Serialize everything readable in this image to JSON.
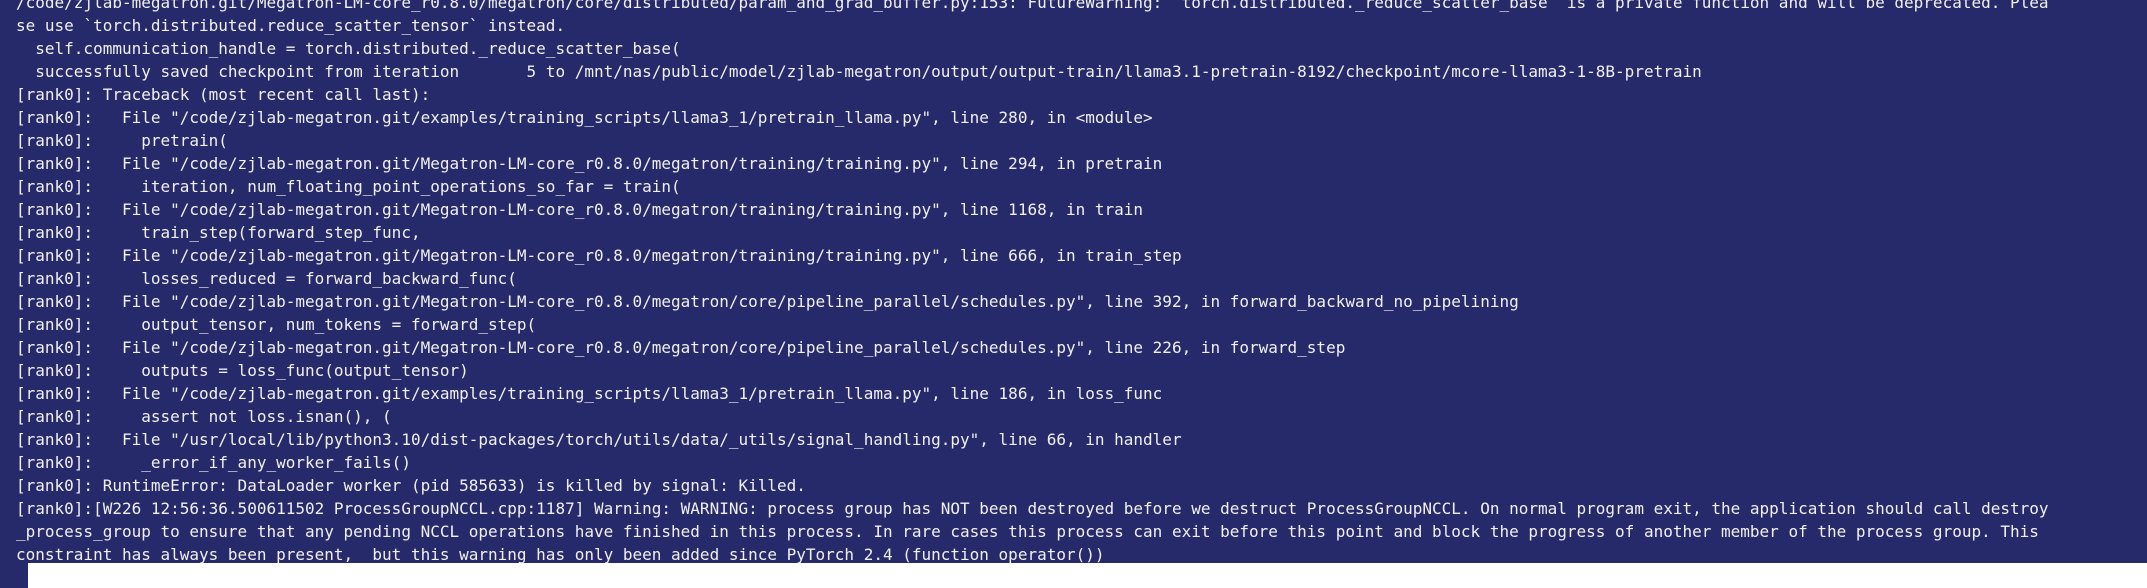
{
  "terminal": {
    "lines": [
      "/code/zjlab-megatron.git/Megatron-LM-core_r0.8.0/megatron/core/distributed/param_and_grad_buffer.py:153: FutureWarning: `torch.distributed._reduce_scatter_base` is a private function and will be deprecated. Plea",
      "se use `torch.distributed.reduce_scatter_tensor` instead.",
      "  self.communication_handle = torch.distributed._reduce_scatter_base(",
      "  successfully saved checkpoint from iteration       5 to /mnt/nas/public/model/zjlab-megatron/output/output-train/llama3.1-pretrain-8192/checkpoint/mcore-llama3-1-8B-pretrain",
      "[rank0]: Traceback (most recent call last):",
      "[rank0]:   File \"/code/zjlab-megatron.git/examples/training_scripts/llama3_1/pretrain_llama.py\", line 280, in <module>",
      "[rank0]:     pretrain(",
      "[rank0]:   File \"/code/zjlab-megatron.git/Megatron-LM-core_r0.8.0/megatron/training/training.py\", line 294, in pretrain",
      "[rank0]:     iteration, num_floating_point_operations_so_far = train(",
      "[rank0]:   File \"/code/zjlab-megatron.git/Megatron-LM-core_r0.8.0/megatron/training/training.py\", line 1168, in train",
      "[rank0]:     train_step(forward_step_func,",
      "[rank0]:   File \"/code/zjlab-megatron.git/Megatron-LM-core_r0.8.0/megatron/training/training.py\", line 666, in train_step",
      "[rank0]:     losses_reduced = forward_backward_func(",
      "[rank0]:   File \"/code/zjlab-megatron.git/Megatron-LM-core_r0.8.0/megatron/core/pipeline_parallel/schedules.py\", line 392, in forward_backward_no_pipelining",
      "[rank0]:     output_tensor, num_tokens = forward_step(",
      "[rank0]:   File \"/code/zjlab-megatron.git/Megatron-LM-core_r0.8.0/megatron/core/pipeline_parallel/schedules.py\", line 226, in forward_step",
      "[rank0]:     outputs = loss_func(output_tensor)",
      "[rank0]:   File \"/code/zjlab-megatron.git/examples/training_scripts/llama3_1/pretrain_llama.py\", line 186, in loss_func",
      "[rank0]:     assert not loss.isnan(), (",
      "[rank0]:   File \"/usr/local/lib/python3.10/dist-packages/torch/utils/data/_utils/signal_handling.py\", line 66, in handler",
      "[rank0]:     _error_if_any_worker_fails()",
      "[rank0]: RuntimeError: DataLoader worker (pid 585633) is killed by signal: Killed.",
      "[rank0]:[W226 12:56:36.500611502 ProcessGroupNCCL.cpp:1187] Warning: WARNING: process group has NOT been destroyed before we destruct ProcessGroupNCCL. On normal program exit, the application should call destroy",
      "_process_group to ensure that any pending NCCL operations have finished in this process. In rare cases this process can exit before this point and block the progress of another member of the process group. This",
      "constraint has always been present,  but this warning has only been added since PyTorch 2.4 (function operator())"
    ]
  }
}
